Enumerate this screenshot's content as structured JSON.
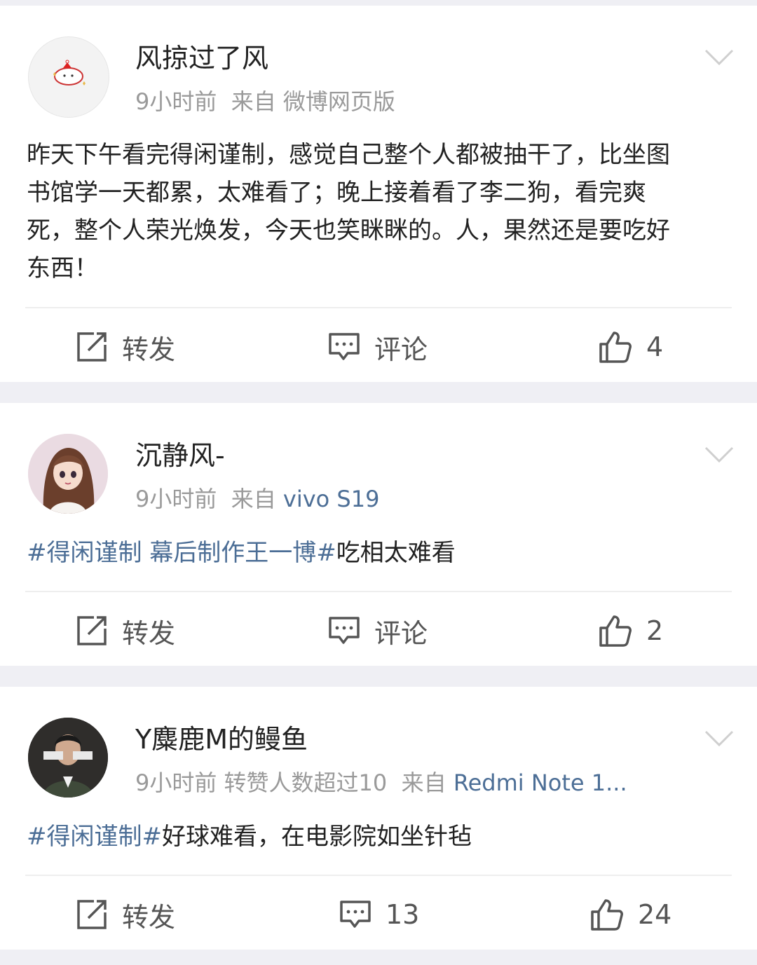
{
  "posts": [
    {
      "username": "风掠过了风",
      "time": "9小时前",
      "extra": "",
      "from_label": "来自",
      "source": "微博网页版",
      "text_lines": [
        "昨天下午看完得闲谨制，感觉自己整个人都被抽干了，比坐图",
        "书馆学一天都累，太难看了；晚上接着看了李二狗，看完爽",
        "死，整个人荣光焕发，今天也笑眯眯的。人，果然还是要吃好",
        "东西！"
      ],
      "repost_label": "转发",
      "comment_label": "评论",
      "like_count": "4",
      "avatar_icon": "cartoon-cat-avatar"
    },
    {
      "username": "沉静风-",
      "time": "9小时前",
      "extra": "",
      "from_label": "来自",
      "source": "vivo S19",
      "topic": "#得闲谨制 幕后制作王一博#",
      "text_rest": "吃相太难看",
      "repost_label": "转发",
      "comment_label": "评论",
      "like_count": "2",
      "avatar_icon": "cartoon-girl-avatar"
    },
    {
      "username": "Y麋鹿M的鳗鱼",
      "time": "9小时前",
      "extra": "转赞人数超过10",
      "from_label": "来自",
      "source": "Redmi Note 1...",
      "topic": "#得闲谨制#",
      "text_rest": "好球难看，在电影院如坐针毡",
      "repost_label": "转发",
      "comment_count": "13",
      "like_count": "24",
      "avatar_icon": "photo-man-avatar"
    }
  ],
  "colors": {
    "link": "#4c6e96",
    "meta": "#9a9a9a",
    "background": "#efeff4"
  }
}
